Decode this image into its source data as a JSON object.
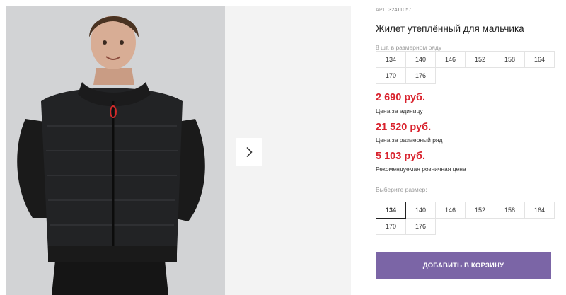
{
  "product": {
    "sku_label": "АРТ.",
    "sku": "32411057",
    "title": "Жилет утеплённый для мальчика",
    "row_note": "8 шт. в размерном ряду",
    "row_sizes": [
      "134",
      "140",
      "146",
      "152",
      "158",
      "164",
      "170",
      "176"
    ]
  },
  "prices": [
    {
      "value": "2 690 руб.",
      "label": "Цена за единицу"
    },
    {
      "value": "21 520 руб.",
      "label": "Цена за размерный ряд"
    },
    {
      "value": "5 103 руб.",
      "label": "Рекомендуемая розничная цена"
    }
  ],
  "size_picker": {
    "label": "Выберите размер:",
    "sizes": [
      "134",
      "140",
      "146",
      "152",
      "158",
      "164",
      "170",
      "176"
    ],
    "selected": "134"
  },
  "cart": {
    "label": "ДОБАВИТЬ В КОРЗИНУ"
  },
  "colors": {
    "accent_red": "#d9232e",
    "cart_purple": "#7b65a6",
    "photo_bg": "#d2d3d5"
  },
  "icons": {
    "next": "chevron-right-icon"
  }
}
